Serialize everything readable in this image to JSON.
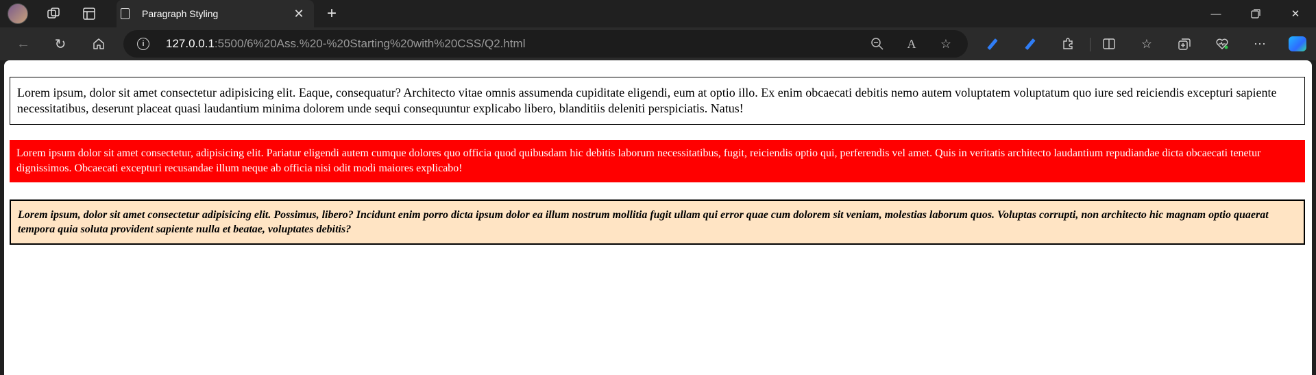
{
  "browser": {
    "tab": {
      "title": "Paragraph Styling"
    },
    "address": {
      "host": "127.0.0.1",
      "path": ":5500/6%20Ass.%20-%20Starting%20with%20CSS/Q2.html"
    }
  },
  "page": {
    "paragraphs": [
      "Lorem ipsum, dolor sit amet consectetur adipisicing elit. Eaque, consequatur? Architecto vitae omnis assumenda cupiditate eligendi, eum at optio illo. Ex enim obcaecati debitis nemo autem voluptatem voluptatum quo iure sed reiciendis excepturi sapiente necessitatibus, deserunt placeat quasi laudantium minima dolorem unde sequi consequuntur explicabo libero, blanditiis deleniti perspiciatis. Natus!",
      "Lorem ipsum dolor sit amet consectetur, adipisicing elit. Pariatur eligendi autem cumque dolores quo officia quod quibusdam hic debitis laborum necessitatibus, fugit, reiciendis optio qui, perferendis vel amet. Quis in veritatis architecto laudantium repudiandae dicta obcaecati tenetur dignissimos. Obcaecati excepturi recusandae illum neque ab officia nisi odit modi maiores explicabo!",
      "Lorem ipsum, dolor sit amet consectetur adipisicing elit. Possimus, libero? Incidunt enim porro dicta ipsum dolor ea illum nostrum mollitia fugit ullam qui error quae cum dolorem sit veniam, molestias laborum quos. Voluptas corrupti, non architecto hic magnam optio quaerat tempora quia soluta provident sapiente nulla et beatae, voluptates debitis?"
    ]
  },
  "icons": {
    "profile": "avatar",
    "workspaces": "workspaces-icon",
    "tab_actions": "tab-actions-icon",
    "page": "page-icon",
    "close": "close-icon",
    "new_tab": "plus-icon",
    "minimize": "minimize-icon",
    "restore": "restore-icon",
    "window_close": "window-close-icon",
    "back": "back-arrow-icon",
    "refresh": "refresh-icon",
    "home": "home-icon",
    "site_info": "info-icon",
    "zoom": "zoom-out-icon",
    "read_aloud": "read-aloud-icon",
    "favorite": "star-icon",
    "extensions": "puzzle-icon",
    "split": "split-screen-icon",
    "favorites": "favorites-icon",
    "collections": "collections-icon",
    "health": "browser-essentials-icon",
    "more": "more-icon",
    "copilot": "copilot-icon"
  },
  "colors": {
    "p2_background": "#ff0000",
    "p3_background": "#ffe4c4"
  }
}
